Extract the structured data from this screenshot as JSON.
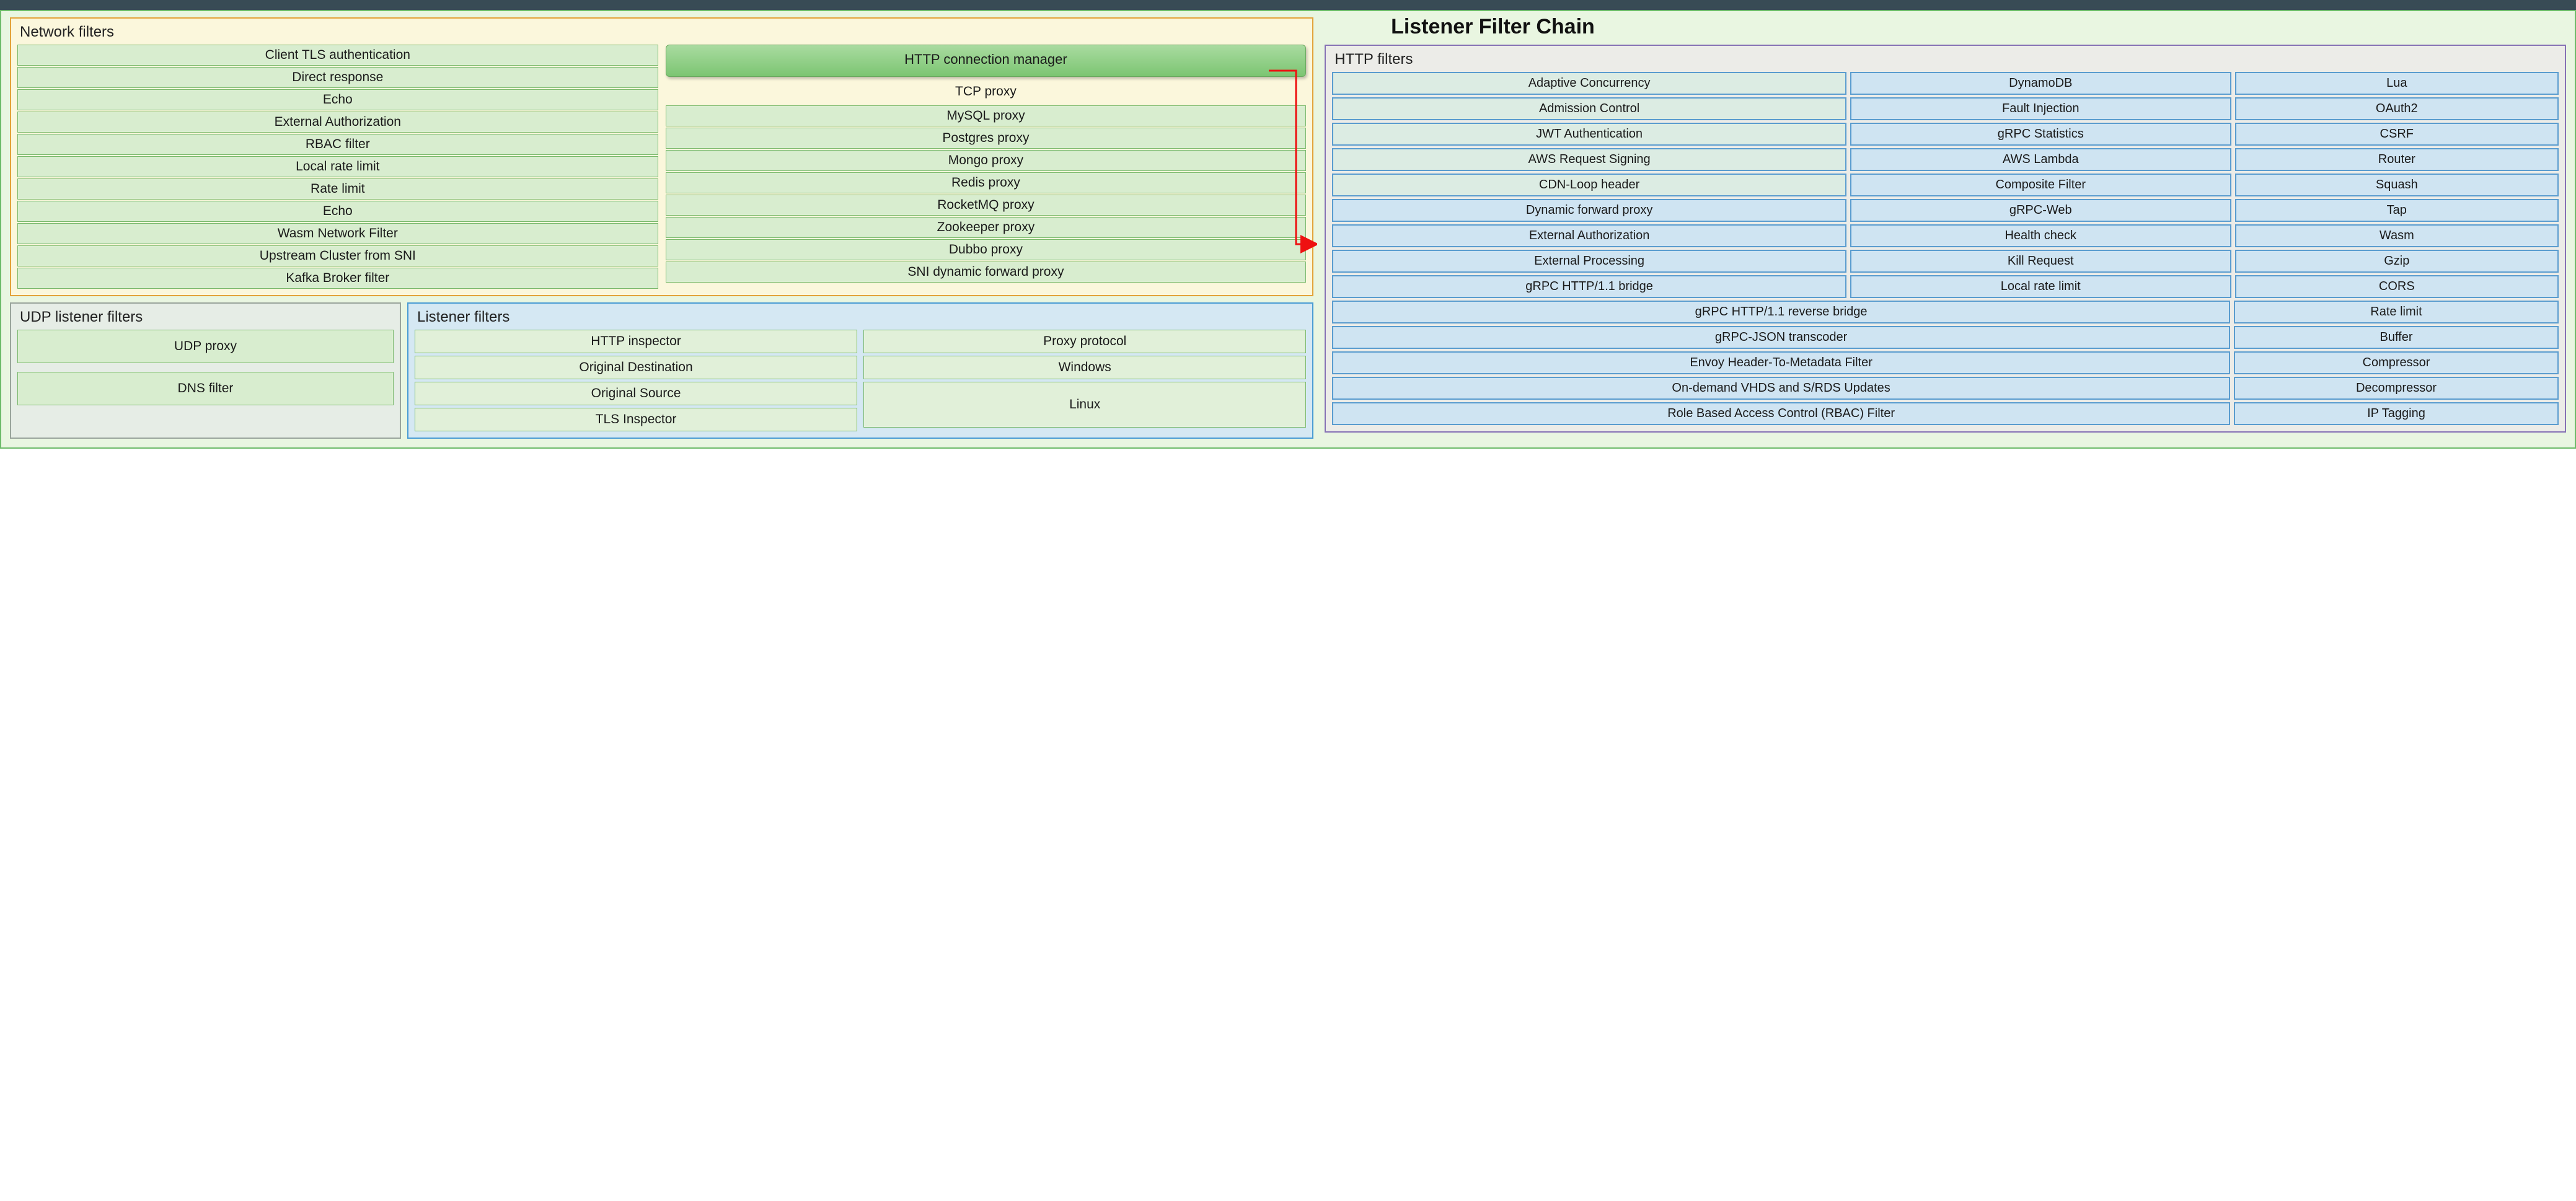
{
  "title": "Listener Filter Chain",
  "network": {
    "title": "Network filters",
    "hcm": "HTTP connection manager",
    "tcp": "TCP proxy",
    "colA": [
      "Client TLS authentication",
      "Direct response",
      "Echo",
      "External Authorization",
      "RBAC filter",
      "Local rate limit",
      "Rate limit",
      "Echo",
      "Wasm Network Filter",
      "Upstream Cluster from SNI",
      "Kafka Broker filter"
    ],
    "colB": [
      "MySQL proxy",
      "Postgres proxy",
      "Mongo proxy",
      "Redis proxy",
      "RocketMQ proxy",
      "Zookeeper proxy",
      "Dubbo proxy",
      "SNI dynamic forward proxy"
    ]
  },
  "udp": {
    "title": "UDP  listener filters",
    "items": [
      "UDP proxy",
      "DNS filter"
    ]
  },
  "listener": {
    "title": "Listener filters",
    "colA": [
      "HTTP inspector",
      "Original Destination",
      "Original Source",
      "TLS Inspector"
    ],
    "colB": [
      "Proxy protocol",
      "Windows",
      "Linux"
    ]
  },
  "http": {
    "title": "HTTP filters",
    "rows3": [
      [
        "Adaptive Concurrency",
        "DynamoDB",
        "Lua"
      ],
      [
        "Admission Control",
        "Fault Injection",
        "OAuth2"
      ],
      [
        "JWT Authentication",
        "gRPC Statistics",
        "CSRF"
      ],
      [
        "AWS Request Signing",
        "AWS Lambda",
        "Router"
      ],
      [
        "CDN-Loop header",
        "Composite Filter",
        "Squash"
      ],
      [
        "Dynamic forward proxy",
        "gRPC-Web",
        "Tap"
      ],
      [
        "External Authorization",
        "Health check",
        "Wasm"
      ],
      [
        "External Processing",
        "Kill Request",
        "Gzip"
      ],
      [
        "gRPC HTTP/1.1 bridge",
        "Local rate limit",
        "CORS"
      ]
    ],
    "rows2": [
      [
        "gRPC HTTP/1.1 reverse bridge",
        "Rate limit"
      ],
      [
        "gRPC-JSON transcoder",
        "Buffer"
      ],
      [
        "Envoy Header-To-Metadata Filter",
        "Compressor"
      ],
      [
        "On-demand VHDS and S/RDS Updates",
        "Decompressor"
      ],
      [
        "Role Based Access Control (RBAC) Filter",
        "IP Tagging"
      ]
    ],
    "greenset": [
      "Adaptive Concurrency",
      "Admission Control",
      "JWT Authentication",
      "AWS Request Signing",
      "CDN-Loop header"
    ]
  }
}
